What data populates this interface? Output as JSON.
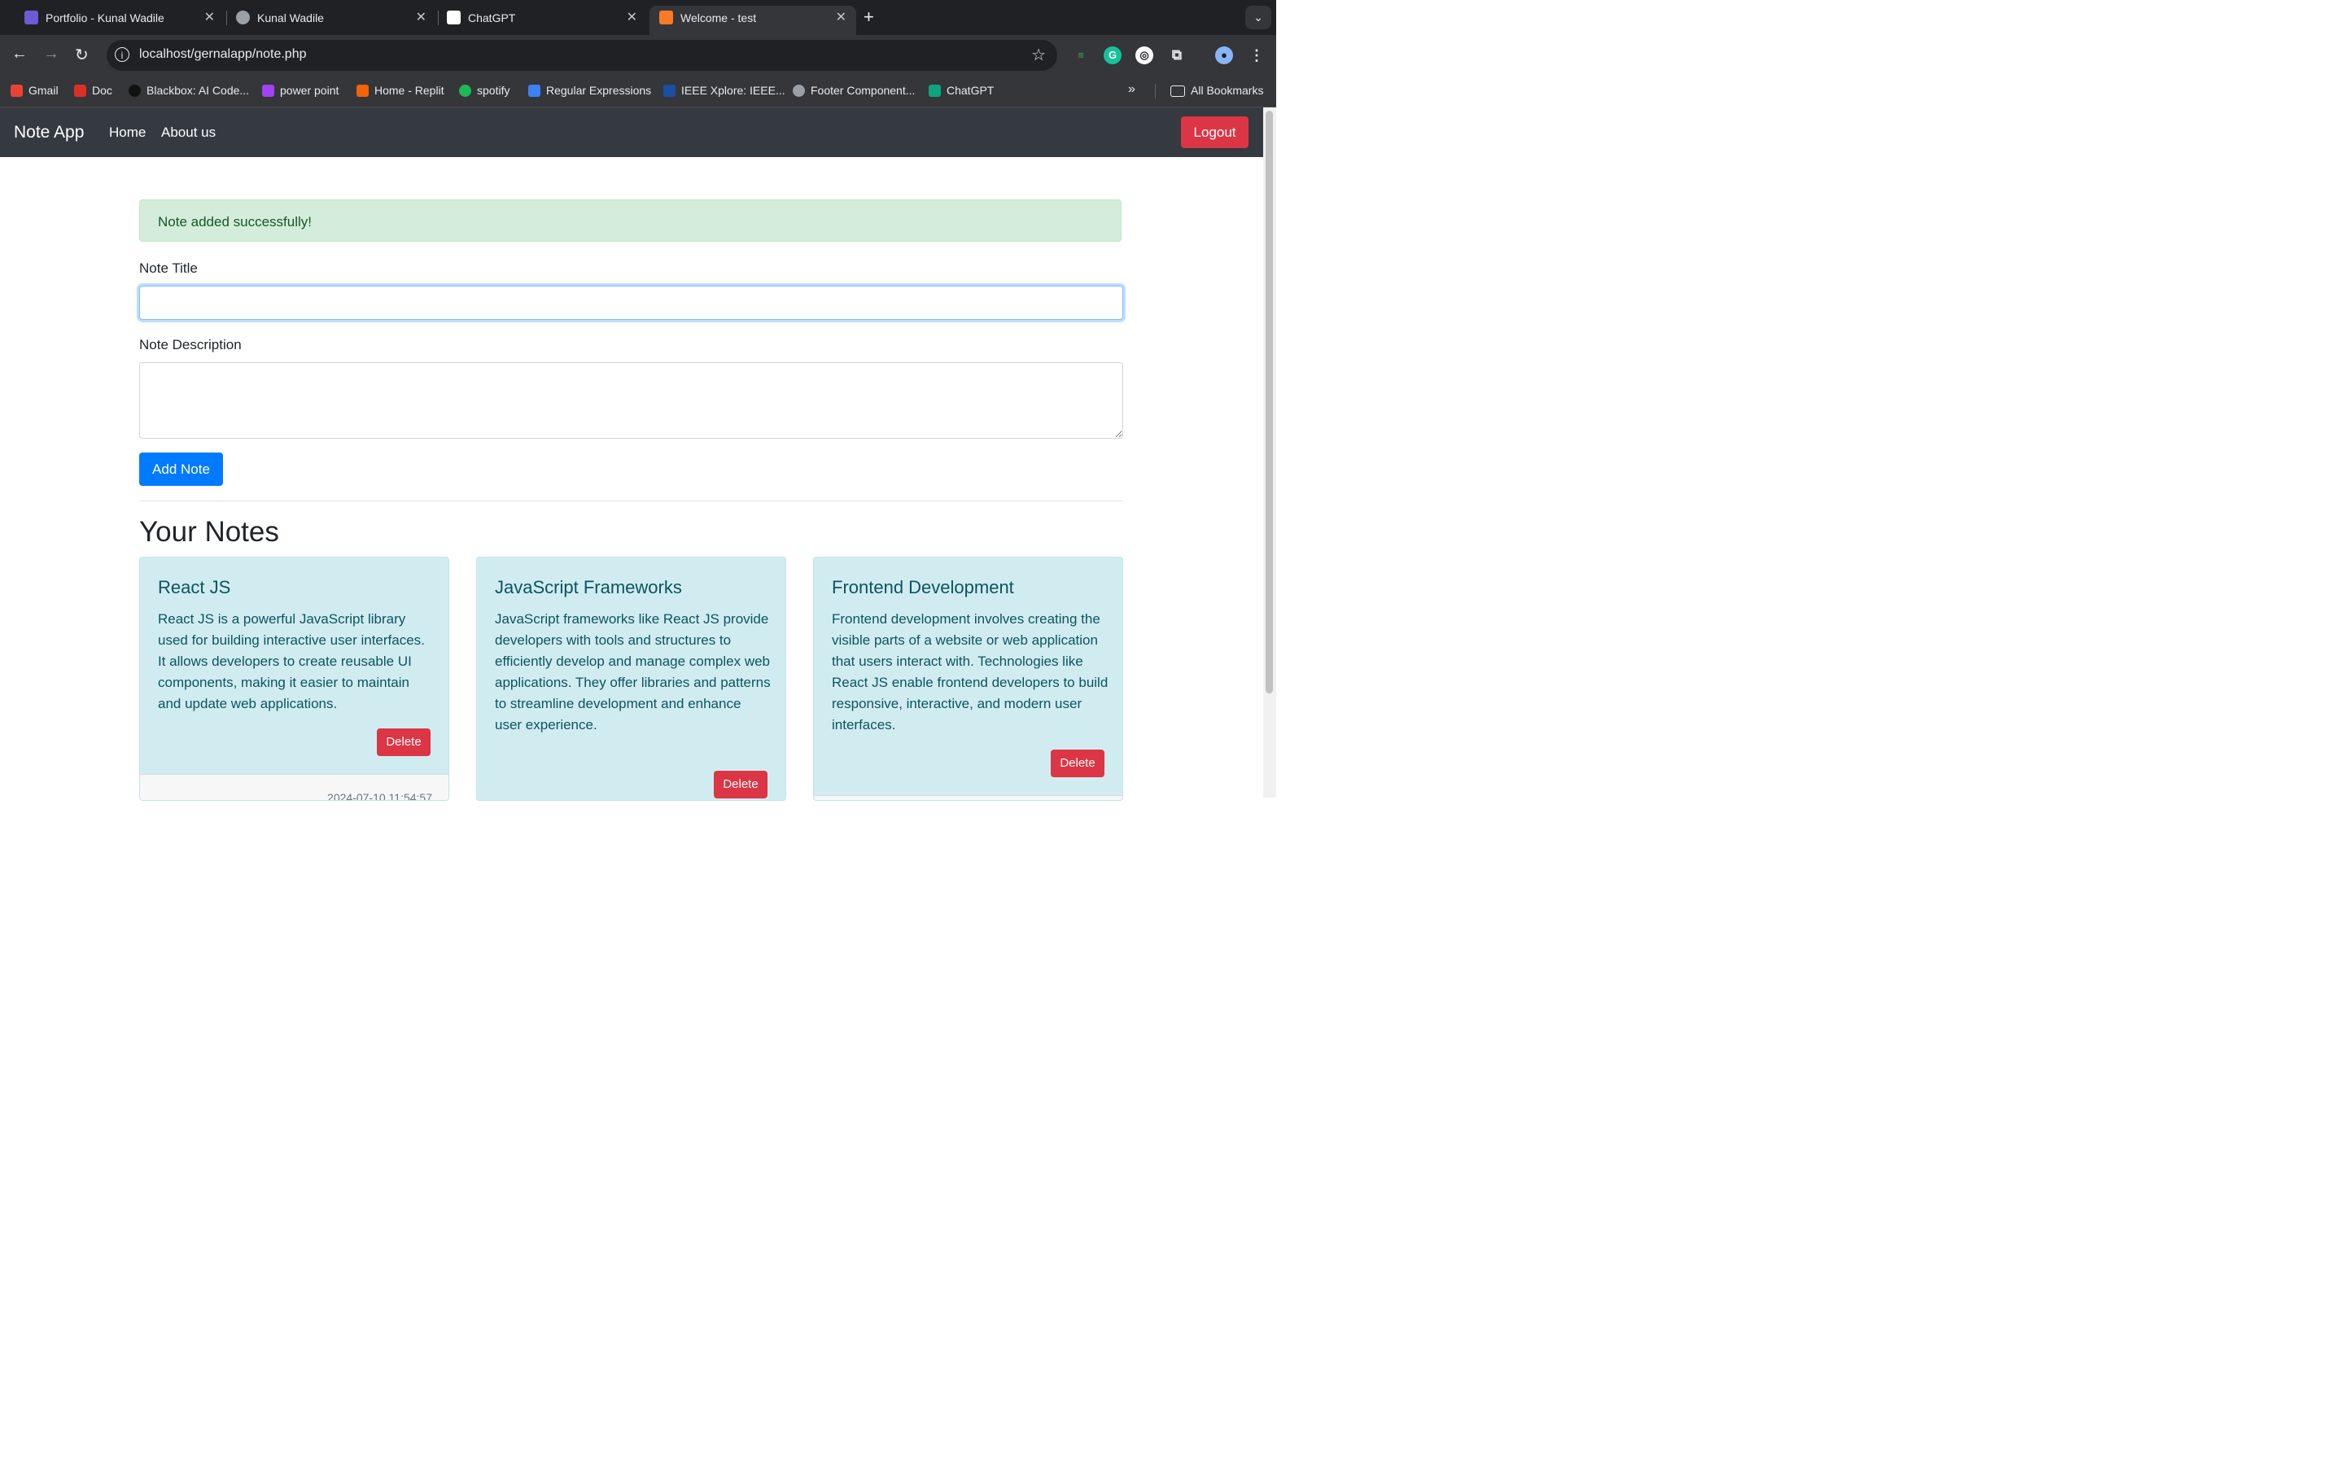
{
  "browser": {
    "tabs": [
      {
        "title": "Portfolio - Kunal Wadile",
        "icon": "portfolio-favicon",
        "active": false
      },
      {
        "title": "Kunal Wadile",
        "icon": "globe-favicon",
        "active": false
      },
      {
        "title": "ChatGPT",
        "icon": "chatgpt-favicon",
        "active": false
      },
      {
        "title": "Welcome - test",
        "icon": "xampp-favicon",
        "active": true
      }
    ],
    "close_glyph": "✕",
    "new_tab_glyph": "+",
    "url": "localhost/gernalapp/note.php",
    "bookmarks": [
      {
        "label": "Gmail",
        "color": "#ea4335"
      },
      {
        "label": "Doc",
        "color": "#d93025"
      },
      {
        "label": "Blackbox: AI Code...",
        "color": "#111111"
      },
      {
        "label": "power point",
        "color": "#a142f4"
      },
      {
        "label": "Home - Replit",
        "color": "#f26207"
      },
      {
        "label": "spotify",
        "color": "#1db954"
      },
      {
        "label": "Regular Expressions",
        "color": "#3b82f6"
      },
      {
        "label": "IEEE Xplore: IEEE...",
        "color": "#1a4fa3"
      },
      {
        "label": "Footer Component...",
        "color": "#9aa0a6"
      },
      {
        "label": "ChatGPT",
        "color": "#10a37f"
      }
    ],
    "all_bookmarks": "All Bookmarks"
  },
  "navbar": {
    "brand": "Note App",
    "links": [
      "Home",
      "About us"
    ],
    "logout": "Logout"
  },
  "alert": {
    "message": "Note added successfully!"
  },
  "form": {
    "title_label": "Note Title",
    "title_value": "",
    "description_label": "Note Description",
    "description_value": "",
    "submit": "Add Note"
  },
  "notes_section": {
    "heading": "Your Notes"
  },
  "notes": [
    {
      "title": "React JS",
      "description": "React JS is a powerful JavaScript library used for building interactive user interfaces. It allows developers to create reusable UI components, making it easier to maintain and update web applications.",
      "delete": "Delete",
      "timestamp": "2024-07-10 11:54:57"
    },
    {
      "title": "JavaScript Frameworks",
      "description": "JavaScript frameworks like React JS provide developers with tools and structures to efficiently develop and manage complex web applications. They offer libraries and patterns to streamline development and enhance user experience.",
      "delete": "Delete",
      "timestamp": ""
    },
    {
      "title": "Frontend Development",
      "description": "Frontend development involves creating the visible parts of a website or web application that users interact with. Technologies like React JS enable frontend developers to build responsive, interactive, and modern user interfaces.",
      "delete": "Delete",
      "timestamp": ""
    }
  ],
  "colors": {
    "navbar": "#343a40",
    "danger": "#dc3545",
    "primary": "#007bff",
    "success_bg": "#d4edda",
    "info_bg": "#d1ecf1"
  }
}
